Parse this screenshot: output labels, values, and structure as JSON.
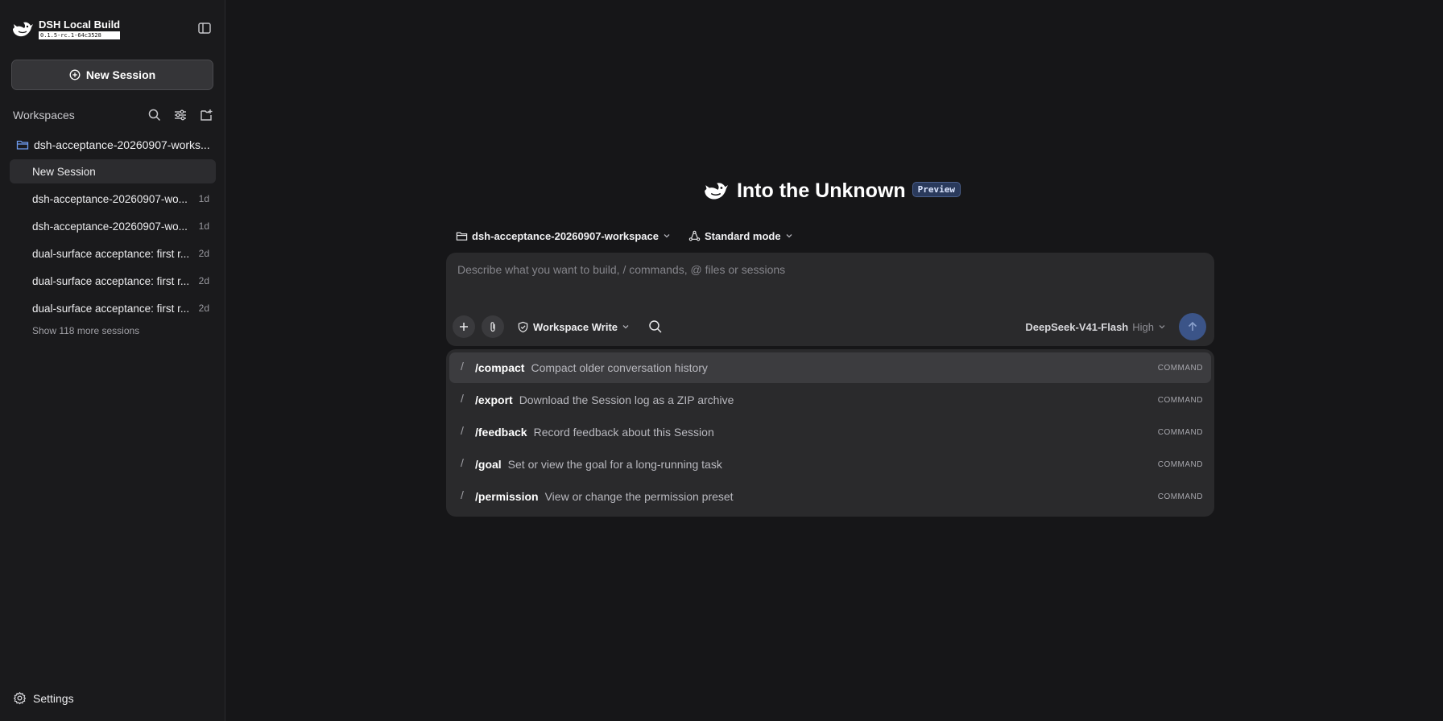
{
  "brand": {
    "title": "DSH Local Build",
    "version": "0.1.5-rc.1-64c3528"
  },
  "sidebar": {
    "new_session_label": "New Session",
    "workspaces_label": "Workspaces",
    "workspace_name": "dsh-acceptance-20260907-works...",
    "sessions": [
      {
        "title": "New Session",
        "age": "",
        "active": true
      },
      {
        "title": "dsh-acceptance-20260907-wo...",
        "age": "1d"
      },
      {
        "title": "dsh-acceptance-20260907-wo...",
        "age": "1d"
      },
      {
        "title": "dual-surface acceptance: first r...",
        "age": "2d"
      },
      {
        "title": "dual-surface acceptance: first r...",
        "age": "2d"
      },
      {
        "title": "dual-surface acceptance: first r...",
        "age": "2d"
      }
    ],
    "show_more_label": "Show 118 more sessions",
    "settings_label": "Settings"
  },
  "main": {
    "hero_title": "Into the Unknown",
    "preview_badge": "Preview",
    "workspace_selector": "dsh-acceptance-20260907-workspace",
    "mode_selector": "Standard mode",
    "composer_placeholder": "Describe what you want to build, / commands, @ files or sessions",
    "permission_label": "Workspace Write",
    "model_name": "DeepSeek-V41-Flash",
    "model_level": "High"
  },
  "commands": [
    {
      "name": "/compact",
      "description": "Compact older conversation history",
      "tag": "COMMAND"
    },
    {
      "name": "/export",
      "description": "Download the Session log as a ZIP archive",
      "tag": "COMMAND"
    },
    {
      "name": "/feedback",
      "description": "Record feedback about this Session",
      "tag": "COMMAND"
    },
    {
      "name": "/goal",
      "description": "Set or view the goal for a long-running task",
      "tag": "COMMAND"
    },
    {
      "name": "/permission",
      "description": "View or change the permission preset",
      "tag": "COMMAND"
    }
  ],
  "colors": {
    "background": "#161618",
    "sidebar": "#1a1a1c",
    "panel": "#2a2a2c",
    "accent_send": "#3b5488",
    "preview_badge": "#2a3a5c"
  },
  "icons": {
    "brand": "whale-logo-icon",
    "toggle": "sidebar-toggle-icon",
    "new_session": "plus-circle-icon",
    "search": "search-icon",
    "filter": "sliders-icon",
    "new_workspace": "folder-plus-icon",
    "folder": "folder-icon",
    "settings": "gear-icon",
    "mode": "cycle-icon",
    "attach": "paperclip-icon",
    "permission": "shield-check-icon",
    "send": "arrow-up-icon"
  }
}
